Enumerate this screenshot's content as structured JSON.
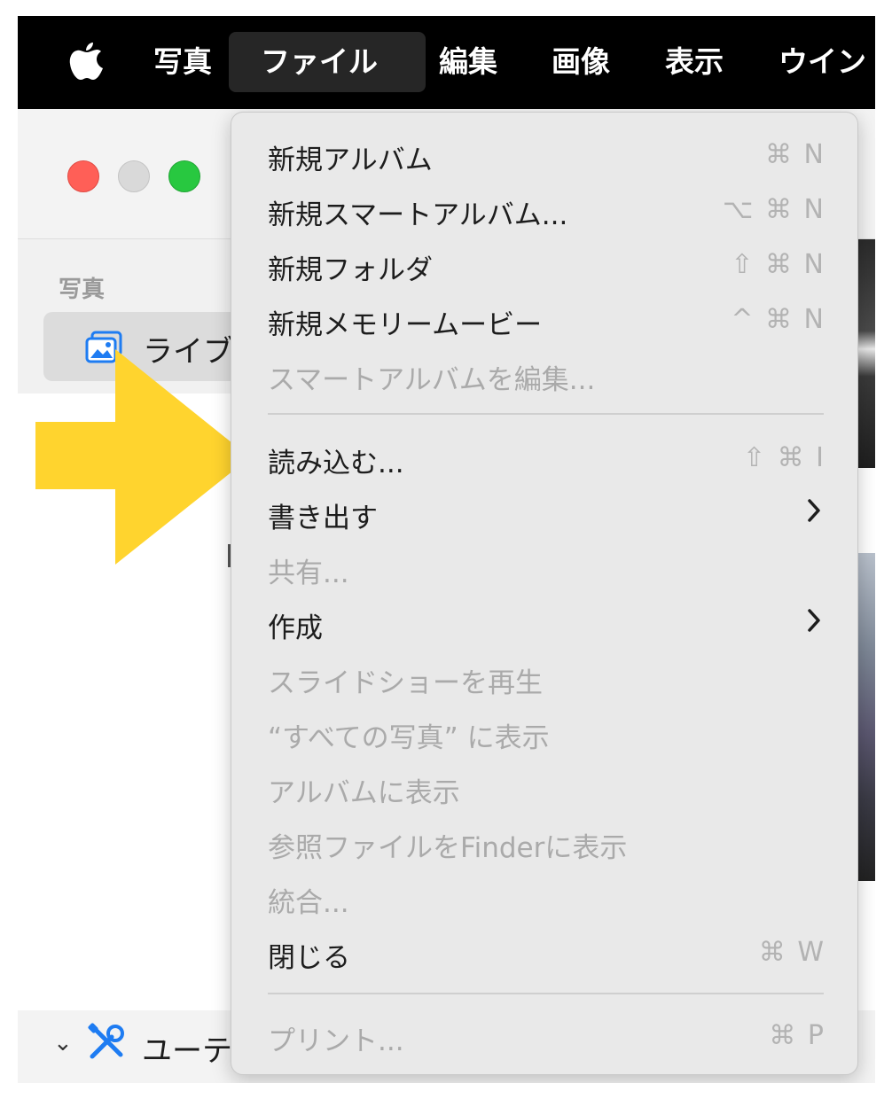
{
  "menubar": {
    "apple_icon": "apple-logo-icon",
    "items": [
      "写真",
      "ファイル",
      "編集",
      "画像",
      "表示",
      "ウイン"
    ]
  },
  "window": {
    "sidebar_heading": "写真",
    "sidebar_library_label": "ライブ",
    "utilities_label": "ユーテ"
  },
  "file_menu": {
    "items": [
      {
        "label": "新規アルバム",
        "shortcut": "⌘ N",
        "enabled": true
      },
      {
        "label": "新規スマートアルバム...",
        "shortcut": "⌥ ⌘ N",
        "enabled": true
      },
      {
        "label": "新規フォルダ",
        "shortcut": "⇧ ⌘ N",
        "enabled": true
      },
      {
        "label": "新規メモリームービー",
        "shortcut": "^ ⌘ N",
        "enabled": true
      },
      {
        "label": "スマートアルバムを編集...",
        "shortcut": "",
        "enabled": false
      },
      {
        "label": "読み込む...",
        "shortcut": "⇧ ⌘ I",
        "enabled": true
      },
      {
        "label": "書き出す",
        "shortcut": "",
        "enabled": true,
        "submenu": true
      },
      {
        "label": "共有...",
        "shortcut": "",
        "enabled": false
      },
      {
        "label": "作成",
        "shortcut": "",
        "enabled": true,
        "submenu": true
      },
      {
        "label": "スライドショーを再生",
        "shortcut": "",
        "enabled": false
      },
      {
        "label": "“すべての写真” に表示",
        "shortcut": "",
        "enabled": false
      },
      {
        "label": "アルバムに表示",
        "shortcut": "",
        "enabled": false
      },
      {
        "label": "参照ファイルをFinderに表示",
        "shortcut": "",
        "enabled": false
      },
      {
        "label": "統合...",
        "shortcut": "",
        "enabled": false
      },
      {
        "label": "閉じる",
        "shortcut": "⌘ W",
        "enabled": true
      },
      {
        "label": "プリント...",
        "shortcut": "⌘ P",
        "enabled": false
      }
    ]
  },
  "colors": {
    "annotation_arrow": "#FFD42E",
    "close_light": "#FF5F57",
    "minimize_light": "#D9D9D9",
    "zoom_light": "#28C840",
    "library_icon": "#1E7CF2"
  }
}
